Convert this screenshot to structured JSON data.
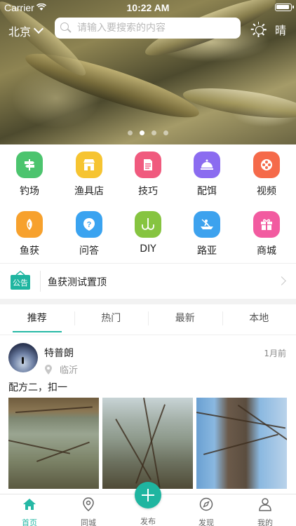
{
  "status_bar": {
    "carrier": "Carrier",
    "time": "10:22 AM"
  },
  "header": {
    "city": "北京",
    "search_placeholder": "请输入要搜索的内容",
    "weather": "晴"
  },
  "banner": {
    "page_count": 4,
    "active_page": 2
  },
  "categories": [
    {
      "label": "钓场",
      "icon": "signpost-icon",
      "color": "#4cc46e"
    },
    {
      "label": "渔具店",
      "icon": "shop-icon",
      "color": "#f6c431"
    },
    {
      "label": "技巧",
      "icon": "document-icon",
      "color": "#f05a7e"
    },
    {
      "label": "配饵",
      "icon": "dish-icon",
      "color": "#8b6cf0"
    },
    {
      "label": "视频",
      "icon": "film-reel-icon",
      "color": "#f56a4a"
    },
    {
      "label": "鱼获",
      "icon": "fish-icon",
      "color": "#f7a12d"
    },
    {
      "label": "问答",
      "icon": "question-icon",
      "color": "#3aa3f0"
    },
    {
      "label": "DIY",
      "icon": "hook-icon",
      "color": "#86c440"
    },
    {
      "label": "路亚",
      "icon": "boat-icon",
      "color": "#3da2ee"
    },
    {
      "label": "商城",
      "icon": "gift-icon",
      "color": "#f25ba0"
    }
  ],
  "notice": {
    "badge": "公告",
    "text": "鱼获测试置顶"
  },
  "tabs": [
    "推荐",
    "热门",
    "最新",
    "本地"
  ],
  "post": {
    "username": "特普朗",
    "time": "1月前",
    "location": "临沂",
    "text": "配方二，扣一"
  },
  "tabbar": {
    "items": [
      {
        "label": "首页",
        "icon": "home-icon"
      },
      {
        "label": "同城",
        "icon": "location-icon"
      },
      {
        "label": "发布",
        "icon": "plus-icon"
      },
      {
        "label": "发现",
        "icon": "compass-icon"
      },
      {
        "label": "我的",
        "icon": "person-icon"
      }
    ]
  },
  "colors": {
    "accent": "#1fb5a0",
    "active_tab": "#26b8a5"
  }
}
